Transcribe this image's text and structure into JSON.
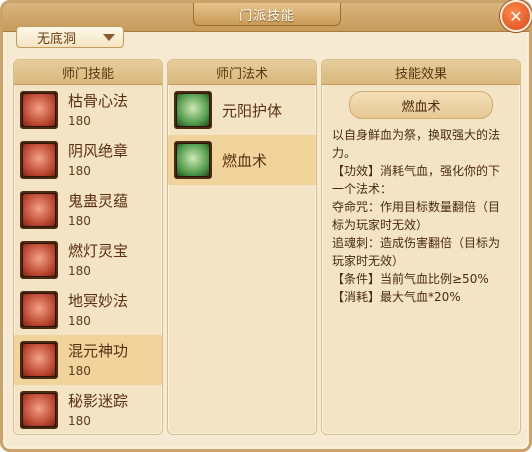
{
  "window": {
    "title": "门派技能"
  },
  "dropdown": {
    "selected": "无底洞"
  },
  "skills_panel": {
    "header": "师门技能",
    "items": [
      {
        "name": "枯骨心法",
        "level": "180"
      },
      {
        "name": "阴风绝章",
        "level": "180"
      },
      {
        "name": "鬼蛊灵蕴",
        "level": "180"
      },
      {
        "name": "燃灯灵宝",
        "level": "180"
      },
      {
        "name": "地冥妙法",
        "level": "180"
      },
      {
        "name": "混元神功",
        "level": "180"
      },
      {
        "name": "秘影迷踪",
        "level": "180"
      }
    ],
    "selected_index": 5
  },
  "spells_panel": {
    "header": "师门法术",
    "items": [
      {
        "name": "元阳护体"
      },
      {
        "name": "燃血术"
      }
    ],
    "selected_index": 1
  },
  "effect_panel": {
    "header": "技能效果",
    "spell_title": "燃血术",
    "lines": [
      "以自身鲜血为祭，换取强大的法力。",
      "【功效】消耗气血，强化你的下一个法术：",
      "夺命咒：作用目标数量翻倍（目标为玩家时无效）",
      "追魂刺：造成伤害翻倍（目标为玩家时无效）",
      "【条件】当前气血比例≥50%",
      "【消耗】最大气血*20%"
    ]
  },
  "colors": {
    "selected_row": "#f0d49c",
    "panel_bg": "#f3e4c5",
    "text_brown": "#5a2f0f"
  }
}
